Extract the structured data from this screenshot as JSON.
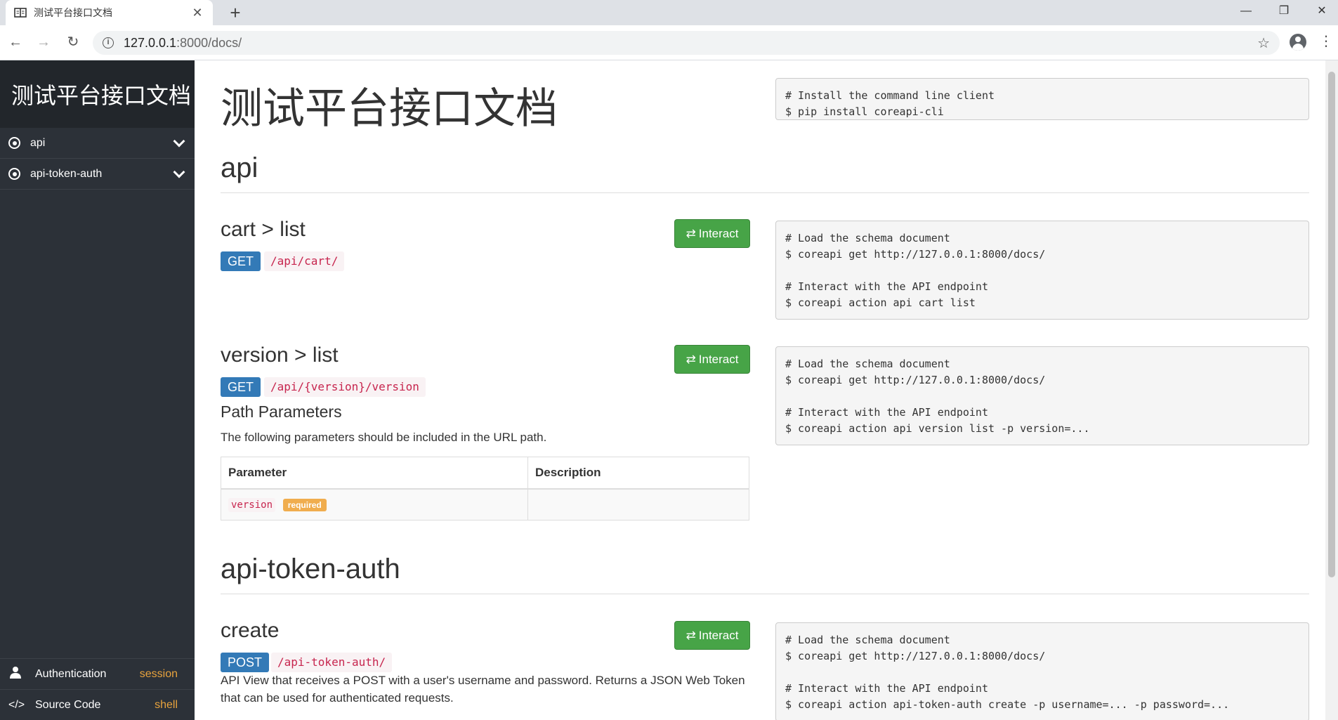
{
  "browser": {
    "tab_title": "测试平台接口文档",
    "url_host": "127.0.0.1",
    "url_rest": ":8000/docs/"
  },
  "sidebar": {
    "brand": "测试平台接口文档",
    "items": [
      {
        "label": "api"
      },
      {
        "label": "api-token-auth"
      }
    ],
    "bottom": [
      {
        "label": "Authentication",
        "value": "session"
      },
      {
        "label": "Source Code",
        "value": "shell"
      }
    ]
  },
  "main": {
    "title": "测试平台接口文档",
    "intro_code": "# Install the command line client\n$ pip install coreapi-cli",
    "interact_label": "Interact",
    "sections": [
      {
        "heading": "api",
        "endpoints": [
          {
            "name": "cart > list",
            "method": "GET",
            "path": "/api/cart/",
            "code": "# Load the schema document\n$ coreapi get http://127.0.0.1:8000/docs/\n\n# Interact with the API endpoint\n$ coreapi action api cart list"
          },
          {
            "name": "version > list",
            "method": "GET",
            "path": "/api/{version}/version",
            "params_heading": "Path Parameters",
            "params_desc": "The following parameters should be included in the URL path.",
            "table_headers": [
              "Parameter",
              "Description"
            ],
            "param_name": "version",
            "param_badge": "required",
            "code": "# Load the schema document\n$ coreapi get http://127.0.0.1:8000/docs/\n\n# Interact with the API endpoint\n$ coreapi action api version list -p version=..."
          }
        ]
      },
      {
        "heading": "api-token-auth",
        "endpoints": [
          {
            "name": "create",
            "method": "POST",
            "path": "/api-token-auth/",
            "description": "API View that receives a POST with a user's username and password. Returns a JSON Web Token that can be used for authenticated requests.",
            "code": "# Load the schema document\n$ coreapi get http://127.0.0.1:8000/docs/\n\n# Interact with the API endpoint\n$ coreapi action api-token-auth create -p username=... -p password=..."
          }
        ]
      }
    ]
  }
}
